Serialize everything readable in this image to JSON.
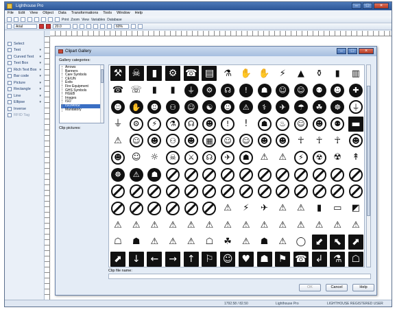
{
  "window": {
    "title": "Lighthouse Pro"
  },
  "menu": [
    "File",
    "Edit",
    "View",
    "Object",
    "Data",
    "Transformations",
    "Tools",
    "Window",
    "Help"
  ],
  "toolbar1": {
    "print": "Print",
    "zoom": "Zoom",
    "view": "View",
    "variables": "Variables",
    "database": "Database"
  },
  "toolbar2": {
    "font": "Arial",
    "size": "20.0",
    "zoom": "60%"
  },
  "toolbox": [
    {
      "label": "Select",
      "arrow": ""
    },
    {
      "label": "Text",
      "arrow": "▾"
    },
    {
      "label": "Curved Text",
      "arrow": "▾"
    },
    {
      "label": "Text Box",
      "arrow": "▾"
    },
    {
      "label": "Rich Text Box",
      "arrow": "▾"
    },
    {
      "label": "Bar code",
      "arrow": "▾"
    },
    {
      "label": "Picture",
      "arrow": "▾"
    },
    {
      "label": "Rectangle",
      "arrow": "▾"
    },
    {
      "label": "Line",
      "arrow": "▾"
    },
    {
      "label": "Ellipse",
      "arrow": "▾"
    },
    {
      "label": "Inverse",
      "arrow": ""
    },
    {
      "label": "RFID Tag",
      "arrow": ""
    }
  ],
  "dialog": {
    "title": "Clipart Gallery",
    "categories_label": "Gallery categories:",
    "categories": [
      "Arrows",
      "Banners",
      "Care Symbols",
      "CE/UN",
      "Exits",
      "Fire Equipment",
      "GHS Symbols",
      "HGEB",
      "Images",
      "ISO",
      "ISO/ANSI",
      "Mandatory"
    ],
    "selected_category": "ISO/ANSI",
    "clip_pictures_label": "Clip pictures:",
    "clip_name_label": "Clip file name:",
    "clip_name_value": "",
    "ok": "OK",
    "cancel": "Cancel",
    "help": "Help"
  },
  "status": {
    "coords": "1792.58 / 82.50",
    "product": "Lighthouse Pro",
    "license": "LIGHTHOUSE REGISTERED USER"
  },
  "symbols": [
    [
      "sq:⚒",
      "sq:☠",
      "sq:▮",
      "sq:⚙",
      "sq:☎",
      "sq:▤",
      "plain:⚗",
      "plain:✋",
      "plain:✋",
      "plain:⚡",
      "plain:▲",
      "plain:⚱",
      "plain:▮",
      "plain:▥"
    ],
    [
      "plain:☎",
      "plain:☏",
      "plain:▮",
      "plain:▮",
      "circ:⏚",
      "circ:⚙",
      "circ:☊",
      "circ:!",
      "circ:☗",
      "circ:☺",
      "circ:☺",
      "circ:⚉",
      "circ:☻",
      "circ:✚"
    ],
    [
      "circ:☻",
      "circ:✋",
      "circ:☻",
      "circ:⚇",
      "circ:☺",
      "circ:☯",
      "circ:☻",
      "circ:⚠",
      "circ:⚕",
      "circ:✈",
      "circ:☂",
      "circ:☘",
      "circ:☸",
      "ring:⏚"
    ],
    [
      "plain:⏚",
      "ring:⚙",
      "ring:⚡",
      "ring:⚗",
      "ring:☊",
      "ring:☻",
      "ring:!",
      "plain:!",
      "ring:☗",
      "ring:♨",
      "ring:☺",
      "ring:☻",
      "ring:⚉",
      "sq:▬"
    ],
    [
      "plain:⚠",
      "ring:☺",
      "ring:☻",
      "ring:⚇",
      "ring:☻",
      "ring:▦",
      "ring:☺",
      "ring:☺",
      "ring:☻",
      "ring:☻",
      "plain:☥",
      "plain:☥",
      "plain:☥",
      "ring:☻"
    ],
    [
      "ring:☻",
      "plain:☺",
      "plain:☼",
      "ring:☠",
      "ring:⚔",
      "ring:☊",
      "ring:✈",
      "ring:☗",
      "plain:⚠",
      "plain:⚠",
      "ring:⚡",
      "ring:☢",
      "plain:☢",
      "plain:↟"
    ],
    [
      "circ:☸",
      "circ:⚠",
      "circ:☗",
      "prohib",
      "prohib",
      "prohib",
      "prohib",
      "prohib",
      "prohib",
      "prohib",
      "prohib",
      "prohib",
      "prohib",
      "prohib"
    ],
    [
      "prohib",
      "prohib",
      "prohib",
      "prohib",
      "prohib",
      "prohib",
      "prohib",
      "prohib",
      "prohib",
      "prohib",
      "prohib",
      "prohib",
      "prohib",
      "prohib"
    ],
    [
      "prohib",
      "prohib",
      "prohib",
      "prohib",
      "prohib",
      "prohib",
      "plain:⚠",
      "plain:⚡",
      "plain:✈",
      "plain:⚠",
      "plain:⚠",
      "plain:▮",
      "plain:▭",
      "plain:◩"
    ],
    [
      "plain:⚠",
      "plain:⚠",
      "plain:⚠",
      "plain:⚠",
      "plain:⚠",
      "plain:⚠",
      "plain:⚠",
      "plain:⚠",
      "plain:⚠",
      "plain:⚠",
      "plain:⚠",
      "plain:⚠",
      "plain:⚠",
      "plain:⚠"
    ],
    [
      "plain:☖",
      "plain:☗",
      "plain:⚠",
      "plain:⚠",
      "plain:⚠",
      "plain:☖",
      "plain:☘",
      "plain:⚠",
      "plain:☗",
      "plain:⚠",
      "plain:◯",
      "sq:⬋",
      "sq:⬉",
      "sq:⬈"
    ],
    [
      "sq:⬈",
      "sq:↓",
      "sq:←",
      "sq:→",
      "sq:↑",
      "sq:⚐",
      "sq:☺",
      "sq:♥",
      "sq:☗",
      "sq:⚑",
      "sq:☎",
      "sq:↲",
      "sq:⚗",
      "sq:☖"
    ]
  ]
}
